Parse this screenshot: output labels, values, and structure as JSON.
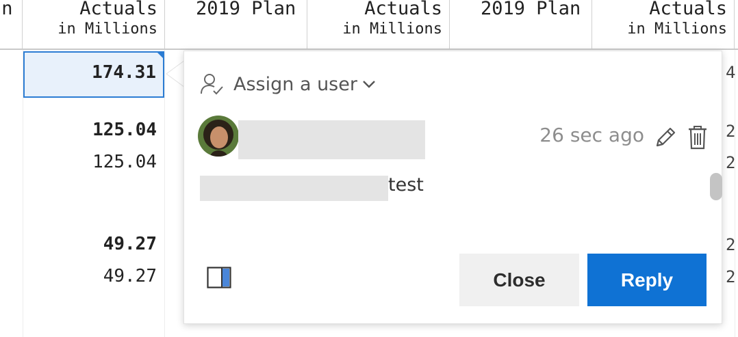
{
  "grid": {
    "headers": [
      {
        "line1": "an",
        "line2": ""
      },
      {
        "line1": "Actuals",
        "line2": "in Millions"
      },
      {
        "line1": "2019 Plan",
        "line2": ""
      },
      {
        "line1": "Actuals",
        "line2": "in Millions"
      },
      {
        "line1": "2019 Plan",
        "line2": ""
      },
      {
        "line1": "Actuals",
        "line2": "in Millions"
      }
    ],
    "selected_value": "174.31",
    "values": [
      {
        "text": "125.04",
        "bold": true
      },
      {
        "text": "125.04",
        "bold": false
      },
      {
        "text": "49.27",
        "bold": true
      },
      {
        "text": "49.27",
        "bold": false
      }
    ],
    "edge_chars": [
      "4",
      "2",
      "2",
      "2",
      "2"
    ]
  },
  "comment": {
    "assign_label": "Assign a user",
    "timestamp": "26 sec ago",
    "message_suffix": "test",
    "close_label": "Close",
    "reply_label": "Reply"
  },
  "colors": {
    "accent": "#0f72d4",
    "selection_border": "#2b7cd3",
    "selection_fill": "#e8f1fb"
  },
  "icons": {
    "assign": "person-check-icon",
    "dropdown": "chevron-down-icon",
    "edit": "pencil-icon",
    "delete": "trash-icon",
    "layout": "panel-toggle-icon"
  }
}
